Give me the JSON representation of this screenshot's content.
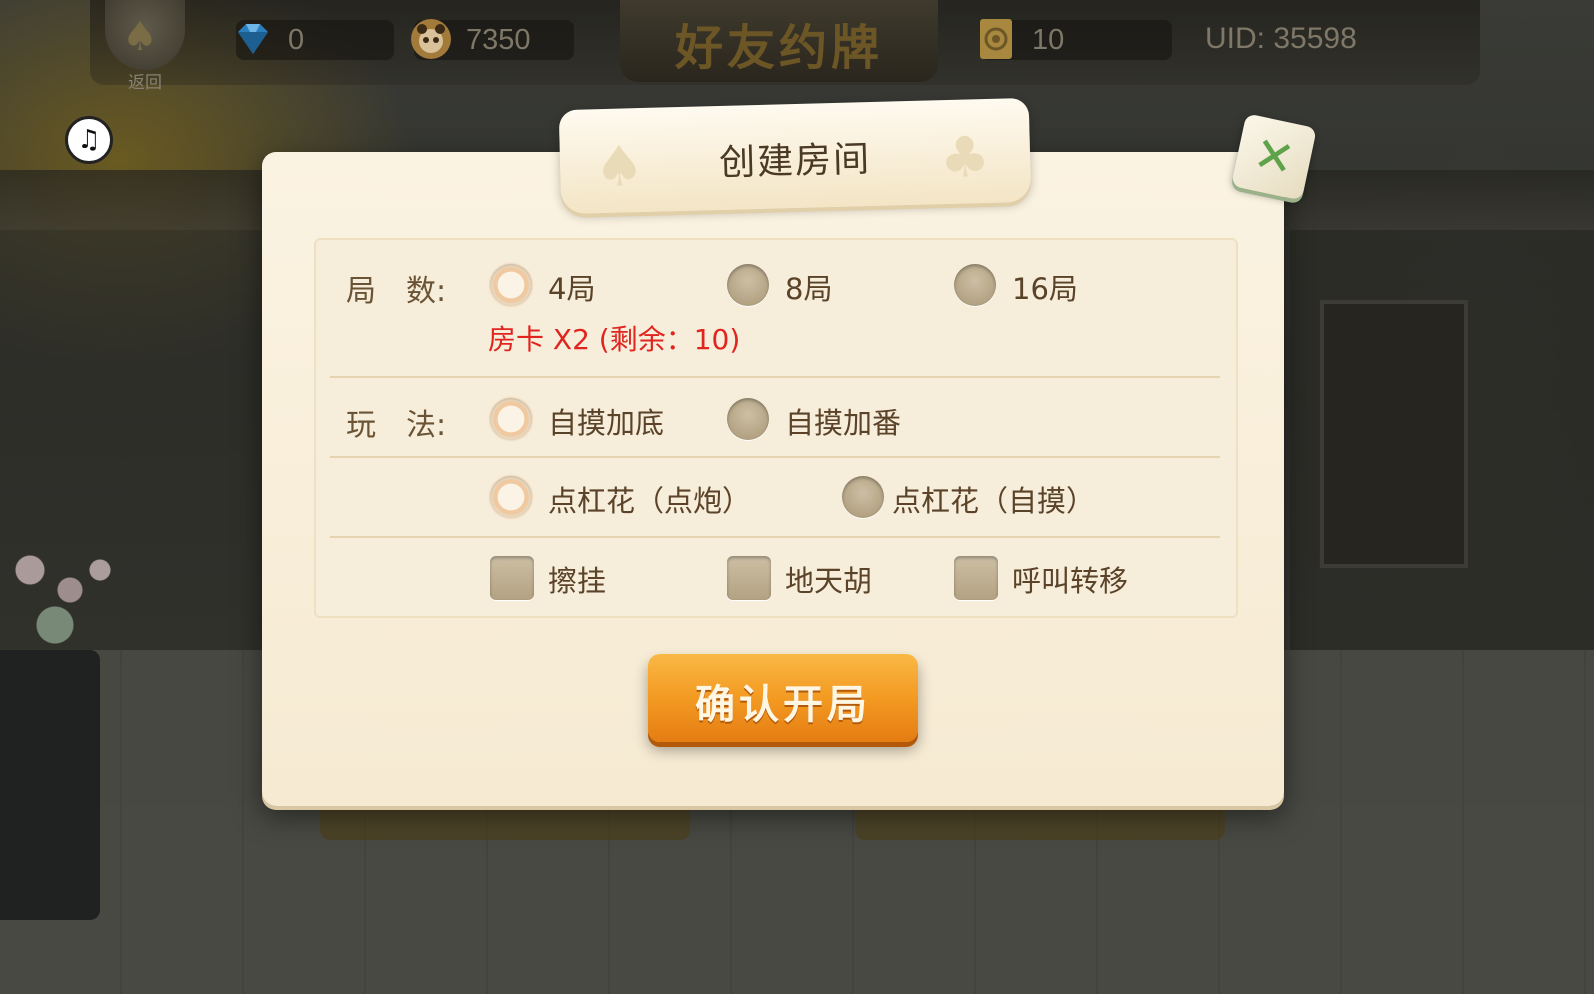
{
  "colors": {
    "accent_orange": "#f39a22",
    "warning_red": "#e0251f",
    "dialog_bg": "#fbf3e2"
  },
  "topbar": {
    "back_label": "返回",
    "diamonds": "0",
    "coins": "7350",
    "title": "好友约牌",
    "room_cards": "10",
    "uid": "UID: 35598",
    "icons": [
      "back-spade-arrow",
      "diamond",
      "panda-coin",
      "room-card",
      "music-off"
    ]
  },
  "dialog": {
    "title": "创建房间",
    "rounds": {
      "label": "局　数:",
      "options": [
        {
          "label": "4局",
          "selected": true
        },
        {
          "label": "8局",
          "selected": false
        },
        {
          "label": "16局",
          "selected": false
        }
      ],
      "cost_note": "房卡 X2 (剩余：10)"
    },
    "rules": {
      "label": "玩　法:",
      "row1": [
        {
          "label": "自摸加底",
          "selected": true
        },
        {
          "label": "自摸加番",
          "selected": false
        }
      ],
      "row2": [
        {
          "label": "点杠花（点炮）",
          "selected": true
        },
        {
          "label": "点杠花（自摸）",
          "selected": false
        }
      ],
      "row3": [
        {
          "label": "擦挂",
          "checked": false
        },
        {
          "label": "地天胡",
          "checked": false
        },
        {
          "label": "呼叫转移",
          "checked": false
        }
      ]
    },
    "confirm_label": "确认开局"
  }
}
